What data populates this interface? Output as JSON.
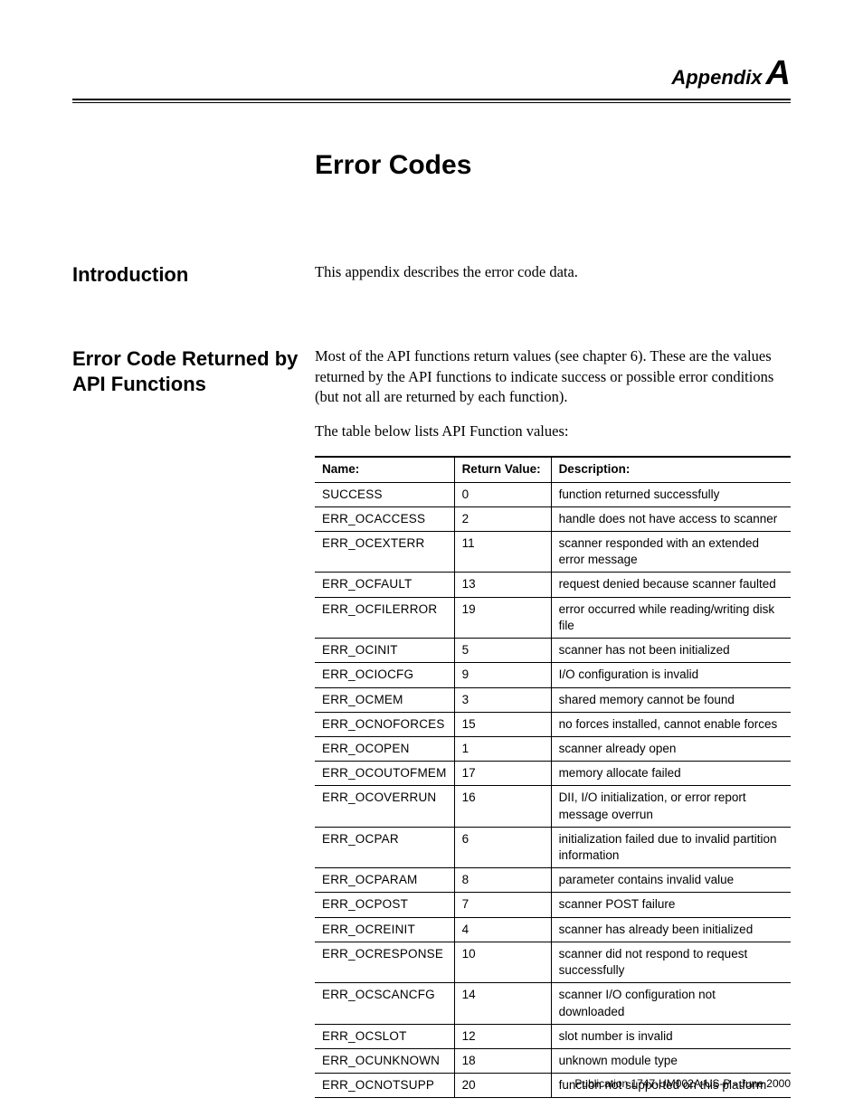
{
  "header": {
    "appendix_word": "Appendix",
    "appendix_letter": "A"
  },
  "chapter_title": "Error Codes",
  "sections": {
    "intro": {
      "heading": "Introduction",
      "body": "This appendix describes the error code data."
    },
    "api": {
      "heading": "Error Code Returned by API Functions",
      "para1": "Most of the API functions return values (see chapter 6). These are the values returned by the API functions to indicate success or possible error conditions (but not all are returned by each function).",
      "para2": "The table below lists API Function values:"
    }
  },
  "table": {
    "headers": {
      "name": "Name:",
      "return_value": "Return Value:",
      "description": "Description:"
    },
    "rows": [
      {
        "name": "SUCCESS",
        "return_value": "0",
        "description": "function returned successfully"
      },
      {
        "name": "ERR_OCACCESS",
        "return_value": "2",
        "description": "handle does not have access to scanner"
      },
      {
        "name": "ERR_OCEXTERR",
        "return_value": "11",
        "description": "scanner responded with an extended error message"
      },
      {
        "name": "ERR_OCFAULT",
        "return_value": "13",
        "description": "request denied because scanner faulted"
      },
      {
        "name": "ERR_OCFILERROR",
        "return_value": "19",
        "description": "error occurred while reading/writing disk file"
      },
      {
        "name": "ERR_OCINIT",
        "return_value": "5",
        "description": "scanner has not been initialized"
      },
      {
        "name": "ERR_OCIOCFG",
        "return_value": "9",
        "description": "I/O configuration is invalid"
      },
      {
        "name": "ERR_OCMEM",
        "return_value": "3",
        "description": "shared memory cannot be found"
      },
      {
        "name": "ERR_OCNOFORCES",
        "return_value": "15",
        "description": "no forces installed, cannot enable forces"
      },
      {
        "name": "ERR_OCOPEN",
        "return_value": "1",
        "description": "scanner already open"
      },
      {
        "name": "ERR_OCOUTOFMEM",
        "return_value": "17",
        "description": "memory allocate failed"
      },
      {
        "name": "ERR_OCOVERRUN",
        "return_value": "16",
        "description": "DII, I/O initialization, or error report message overrun"
      },
      {
        "name": "ERR_OCPAR",
        "return_value": "6",
        "description": "initialization failed due to invalid partition information"
      },
      {
        "name": "ERR_OCPARAM",
        "return_value": "8",
        "description": "parameter contains invalid value"
      },
      {
        "name": "ERR_OCPOST",
        "return_value": "7",
        "description": "scanner POST failure"
      },
      {
        "name": "ERR_OCREINIT",
        "return_value": "4",
        "description": "scanner has already been initialized"
      },
      {
        "name": "ERR_OCRESPONSE",
        "return_value": "10",
        "description": "scanner did not respond to request successfully"
      },
      {
        "name": "ERR_OCSCANCFG",
        "return_value": "14",
        "description": "scanner I/O configuration not downloaded"
      },
      {
        "name": "ERR_OCSLOT",
        "return_value": "12",
        "description": "slot number is invalid"
      },
      {
        "name": "ERR_OCUNKNOWN",
        "return_value": "18",
        "description": "unknown module type"
      },
      {
        "name": "ERR_OCNOTSUPP",
        "return_value": "20",
        "description": "function not supported on this platform"
      }
    ]
  },
  "footer": "Publication 1747-UM002A-US-P - June 2000"
}
